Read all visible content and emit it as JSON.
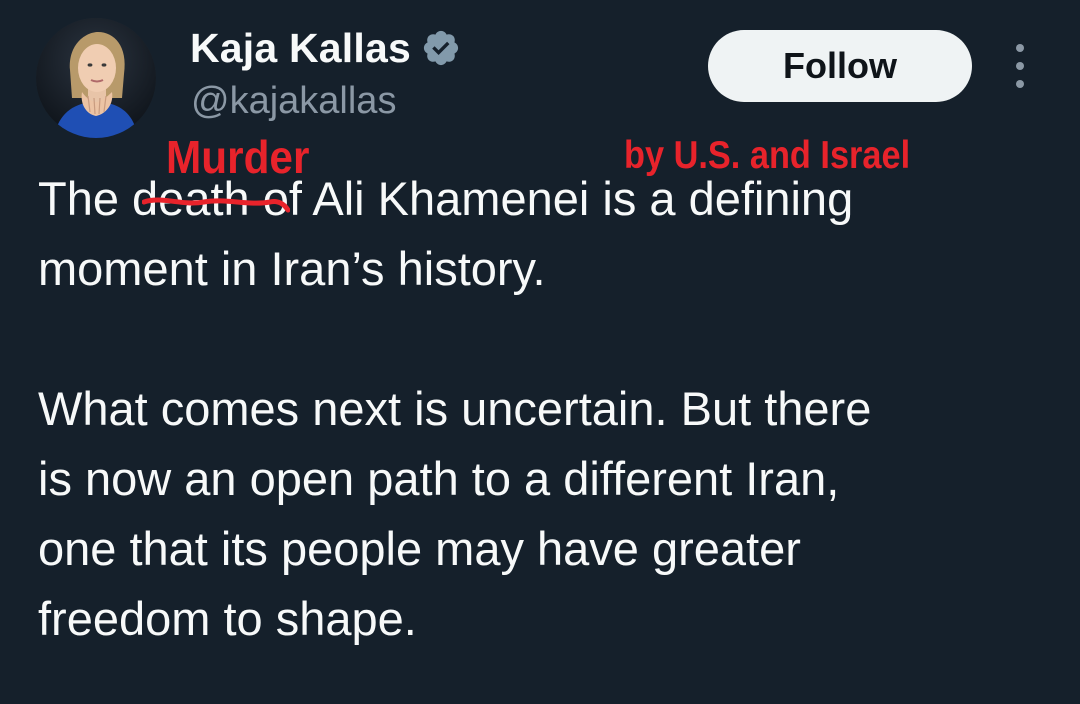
{
  "author": {
    "display_name": "Kaja Kallas",
    "handle": "@kajakallas",
    "verified_badge_color": "#829aab",
    "avatar_icon": "profile-photo"
  },
  "follow_button": {
    "label": "Follow"
  },
  "more_menu_icon": "more-vertical-icon",
  "annotations": {
    "murder": "Murder",
    "by_us_israel": "by U.S. and Israel",
    "color": "#e8232b"
  },
  "tweet": {
    "paragraph1": {
      "line1_prefix": "The ",
      "line1_struck": "death",
      "line1_suffix": " of Ali Khamenei is a defining",
      "line2": "moment in Iran’s history."
    },
    "paragraph2": {
      "line1": "What comes next is uncertain. But there",
      "line2": "is now an open path to a different Iran,",
      "line3": "one that its people may have greater",
      "line4": "freedom to shape."
    }
  },
  "colors": {
    "background": "#15202b",
    "text": "#f7f9f9",
    "secondary_text": "#8b98a5",
    "follow_bg": "#eff3f4"
  }
}
